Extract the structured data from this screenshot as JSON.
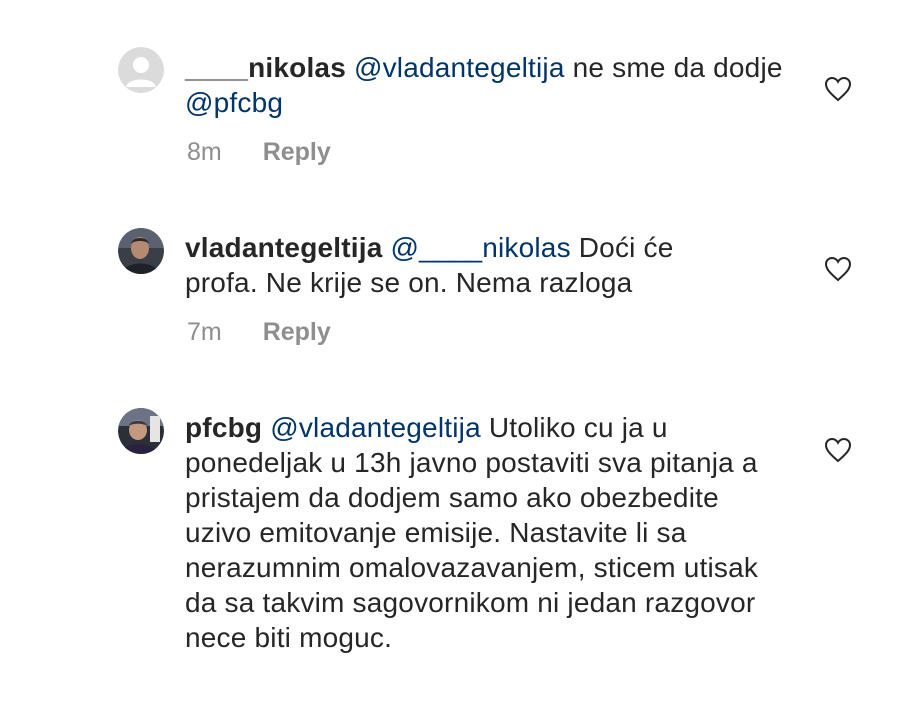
{
  "comments": [
    {
      "username": "____nikolas",
      "mention": "@vladantegeltija",
      "text_before_second_mention": " ne sme da dodje ",
      "mention2": "@pfcbg",
      "time": "8m",
      "reply_label": "Reply",
      "avatar_icon": "default-avatar-icon",
      "like_icon": "heart-outline-icon"
    },
    {
      "username": "vladantegeltija",
      "mention": "@____nikolas",
      "text": " Doći će profa. Ne krije se on. Nema razloga",
      "time": "7m",
      "reply_label": "Reply",
      "avatar_icon": "profile-photo-icon",
      "like_icon": "heart-outline-icon"
    },
    {
      "username": "pfcbg",
      "mention": "@vladantegeltija",
      "text": " Utoliko cu ja u ponedeljak u 13h javno postaviti sva pitanja a pristajem da dodjem samo ako obezbedite uzivo emitovanje emisije. Nastavite li sa nerazumnim omalovazavanjem, sticem utisak da sa takvim sagovornikom ni jedan razgovor nece biti moguc.",
      "avatar_icon": "profile-photo-icon",
      "like_icon": "heart-outline-icon"
    }
  ],
  "colors": {
    "text": "#262626",
    "mention": "#003569",
    "meta": "#8e8e8e"
  }
}
